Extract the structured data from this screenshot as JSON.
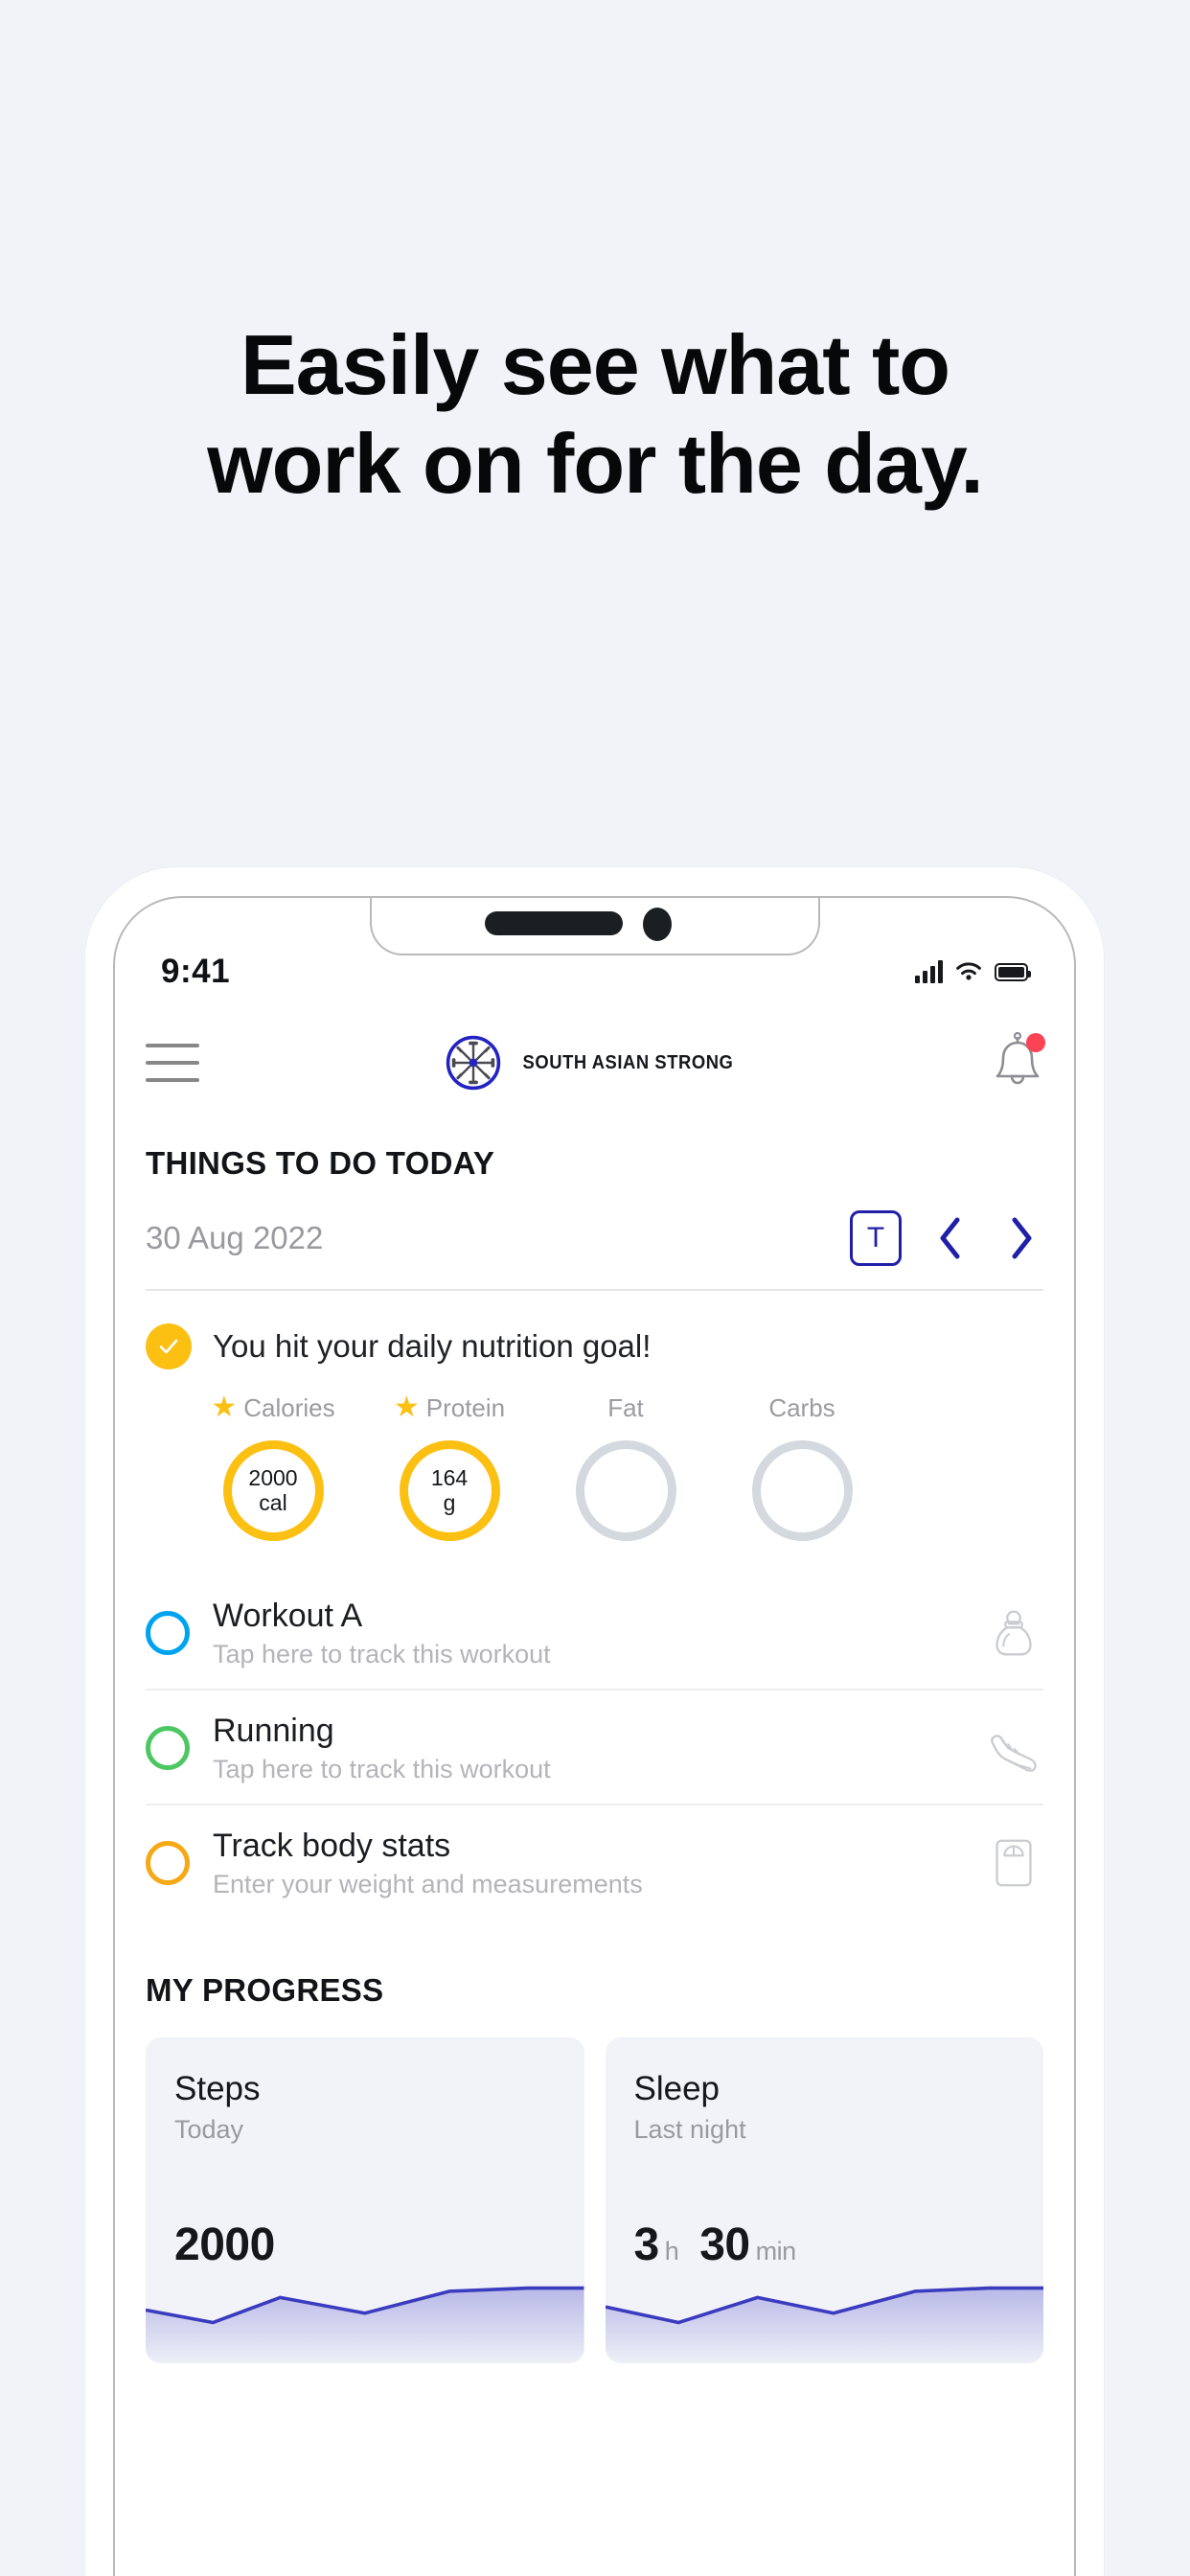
{
  "promo": {
    "headline_line1": "Easily see what to",
    "headline_line2": "work on for the day."
  },
  "status_bar": {
    "time": "9:41",
    "signal_icon": "cellular-signal-icon",
    "wifi_icon": "wifi-icon",
    "battery_icon": "battery-full-icon"
  },
  "app_header": {
    "menu_icon": "hamburger-menu-icon",
    "brand_name": "SOUTH ASIAN STRONG",
    "brand_mark_icon": "chakra-dumbbell-wheel-logo",
    "notifications_icon": "bell-icon",
    "notification_badge": true
  },
  "things_to_do": {
    "section_title": "THINGS TO DO TODAY",
    "date": "30 Aug 2022",
    "today_button_label": "T",
    "prev_icon": "chevron-left-icon",
    "next_icon": "chevron-right-icon"
  },
  "nutrition": {
    "status_icon": "check-circle-icon",
    "message": "You hit your daily nutrition goal!",
    "macros": [
      {
        "label": "Calories",
        "starred": true,
        "value": "2000",
        "unit": "cal",
        "achieved": true
      },
      {
        "label": "Protein",
        "starred": true,
        "value": "164",
        "unit": "g",
        "achieved": true
      },
      {
        "label": "Fat",
        "starred": false,
        "value": "",
        "unit": "",
        "achieved": false
      },
      {
        "label": "Carbs",
        "starred": false,
        "value": "",
        "unit": "",
        "achieved": false
      }
    ]
  },
  "tasks": [
    {
      "title": "Workout A",
      "subtitle": "Tap here to track this workout",
      "circle_color": "#00a3ef",
      "icon": "kettlebell-icon"
    },
    {
      "title": "Running",
      "subtitle": "Tap here to track this workout",
      "circle_color": "#4cc764",
      "icon": "running-shoe-icon"
    },
    {
      "title": "Track body stats",
      "subtitle": "Enter your weight and measurements",
      "circle_color": "#f5a916",
      "icon": "weight-scale-icon"
    }
  ],
  "progress": {
    "section_title": "MY PROGRESS",
    "cards": [
      {
        "title": "Steps",
        "period": "Today",
        "value": "2000",
        "unit": "",
        "value2": "",
        "unit2": ""
      },
      {
        "title": "Sleep",
        "period": "Last night",
        "value": "3",
        "unit": "h",
        "value2": "30",
        "unit2": "min"
      }
    ]
  },
  "colors": {
    "page_background": "#f1f3f8",
    "accent_yellow": "#fcc013",
    "accent_blue": "#1f1fa8",
    "task_blue": "#00a3ef",
    "task_green": "#4cc764",
    "task_orange": "#f5a916",
    "badge_red": "#fc4255",
    "spark_line": "#3b3bbf"
  }
}
